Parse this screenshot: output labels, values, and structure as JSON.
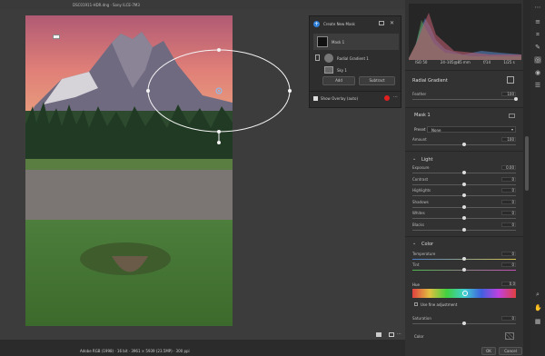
{
  "window": {
    "filename": "DSC01911-HDR.dng  ·  Sony ILCE-7M3"
  },
  "histogram": {
    "info": [
      "ISO 50",
      "24–105@85 mm",
      "f/14",
      "1/25 s"
    ]
  },
  "mask_panel": {
    "create_label": "Create New Mask",
    "mask1": "Mask 1",
    "radial": "Radial Gradient 1",
    "sky": "Sky 1",
    "add": "Add",
    "subtract": "Subtract",
    "overlay": "Show Overlay (auto)"
  },
  "right_panel": {
    "radial_title": "Radial Gradient",
    "feather_label": "Feather",
    "feather_value": "100",
    "feather_level": 1.0,
    "mask_title": "Mask 1",
    "preset_label": "Preset",
    "preset_value": "None",
    "amount_label": "Amount",
    "amount_value": "100",
    "amount_level": 0.5,
    "light_title": "Light",
    "light": [
      {
        "label": "Exposure",
        "value": "0.00",
        "level": 0.5
      },
      {
        "label": "Contrast",
        "value": "0",
        "level": 0.5
      },
      {
        "label": "Highlights",
        "value": "0",
        "level": 0.5
      },
      {
        "label": "Shadows",
        "value": "0",
        "level": 0.5
      },
      {
        "label": "Whites",
        "value": "0",
        "level": 0.5
      },
      {
        "label": "Blacks",
        "value": "0",
        "level": 0.5
      }
    ],
    "color_title": "Color",
    "temperature_label": "Temperature",
    "temperature_value": "0",
    "tint_label": "Tint",
    "tint_value": "0",
    "hue_label": "Hue",
    "hue_value": "0.0",
    "fine_label": "Use fine adjustment",
    "saturation_label": "Saturation",
    "saturation_value": "0",
    "color_label": "Color",
    "ok": "OK",
    "cancel": "Cancel"
  },
  "status": {
    "text": "Adobe RGB (1998) · 16 bit · 3961 × 5939 (23.5MP) · 300 ppi"
  },
  "colors": {
    "accent": "#2f7fd8",
    "panel": "#323232",
    "red_dot": "#e02020"
  }
}
